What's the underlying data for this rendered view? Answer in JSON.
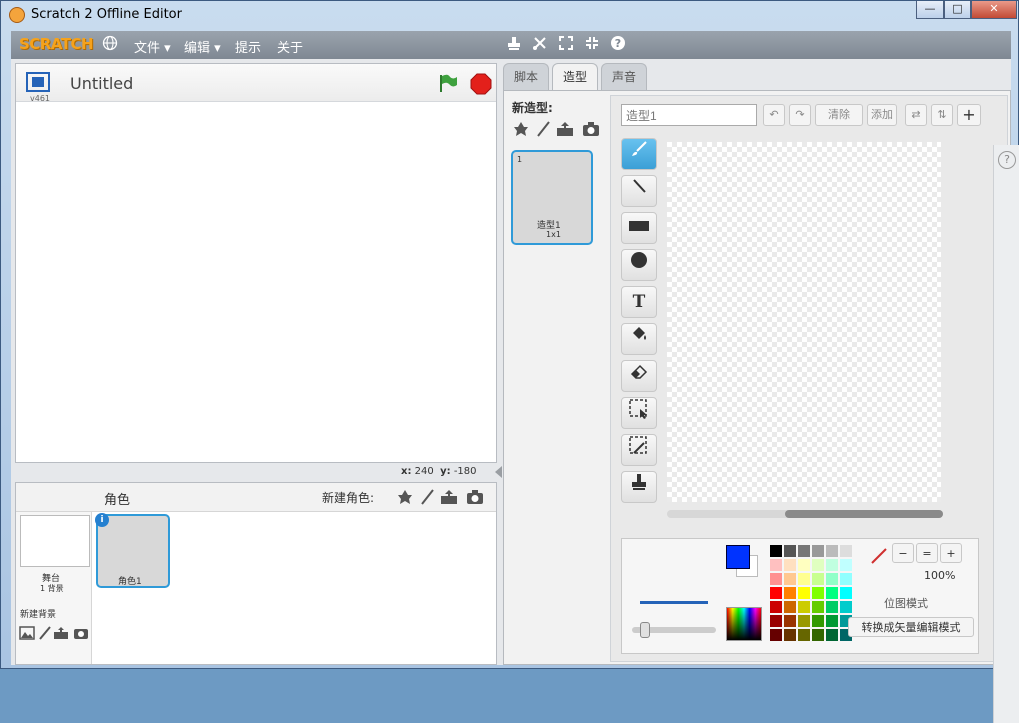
{
  "window": {
    "title": "Scratch 2 Offline Editor",
    "minimize": "—",
    "maximize": "□",
    "close": "✕"
  },
  "menu": {
    "logo": "SCRATCH",
    "file": "文件 ▾",
    "edit": "编辑 ▾",
    "tips": "提示",
    "about": "关于"
  },
  "stage": {
    "version": "v461",
    "title": "Untitled",
    "coords_x_label": "x:",
    "coords_x": "240",
    "coords_y_label": "y:",
    "coords_y": "-180"
  },
  "sprites": {
    "header": "角色",
    "new_sprite_label": "新建角色:",
    "stage_label": "舞台",
    "stage_backdrops": "1 背景",
    "new_backdrop_label": "新建背景",
    "items": [
      {
        "name": "角色1",
        "info": "i"
      }
    ]
  },
  "tabs": [
    {
      "label": "脚本"
    },
    {
      "label": "造型"
    },
    {
      "label": "声音"
    }
  ],
  "costumes": {
    "new_costume_label": "新造型:",
    "items": [
      {
        "index": "1",
        "name": "造型1",
        "size": "1x1"
      }
    ]
  },
  "editor": {
    "costume_name": "造型1",
    "clear_label": "清除",
    "import_label": "添加",
    "zoom": "100%",
    "mode_bitmap": "位图模式",
    "convert_vector": "转换成矢量编辑模式",
    "help": "?"
  },
  "colors": {
    "selected_primary": "#0033ff",
    "selected_secondary": "#ffffff",
    "accent": "#2f9ad8",
    "menubar": "#8a939d",
    "palette": [
      "#000000",
      "#555555",
      "#777777",
      "#999999",
      "#bbbbbb",
      "#dddddd",
      "#ffc0c0",
      "#ffe0c0",
      "#ffffc0",
      "#e0ffc0",
      "#c0ffe0",
      "#c0ffff",
      "#ff9090",
      "#ffc890",
      "#ffff90",
      "#c8ff90",
      "#90ffc8",
      "#90ffff",
      "#ff0000",
      "#ff8000",
      "#ffff00",
      "#80ff00",
      "#00ff80",
      "#00ffff",
      "#cc0000",
      "#cc6600",
      "#cccc00",
      "#66cc00",
      "#00cc66",
      "#00cccc",
      "#990000",
      "#993300",
      "#999900",
      "#339900",
      "#009933",
      "#009999",
      "#660000",
      "#663300",
      "#666600",
      "#336600",
      "#006633",
      "#006666"
    ]
  }
}
